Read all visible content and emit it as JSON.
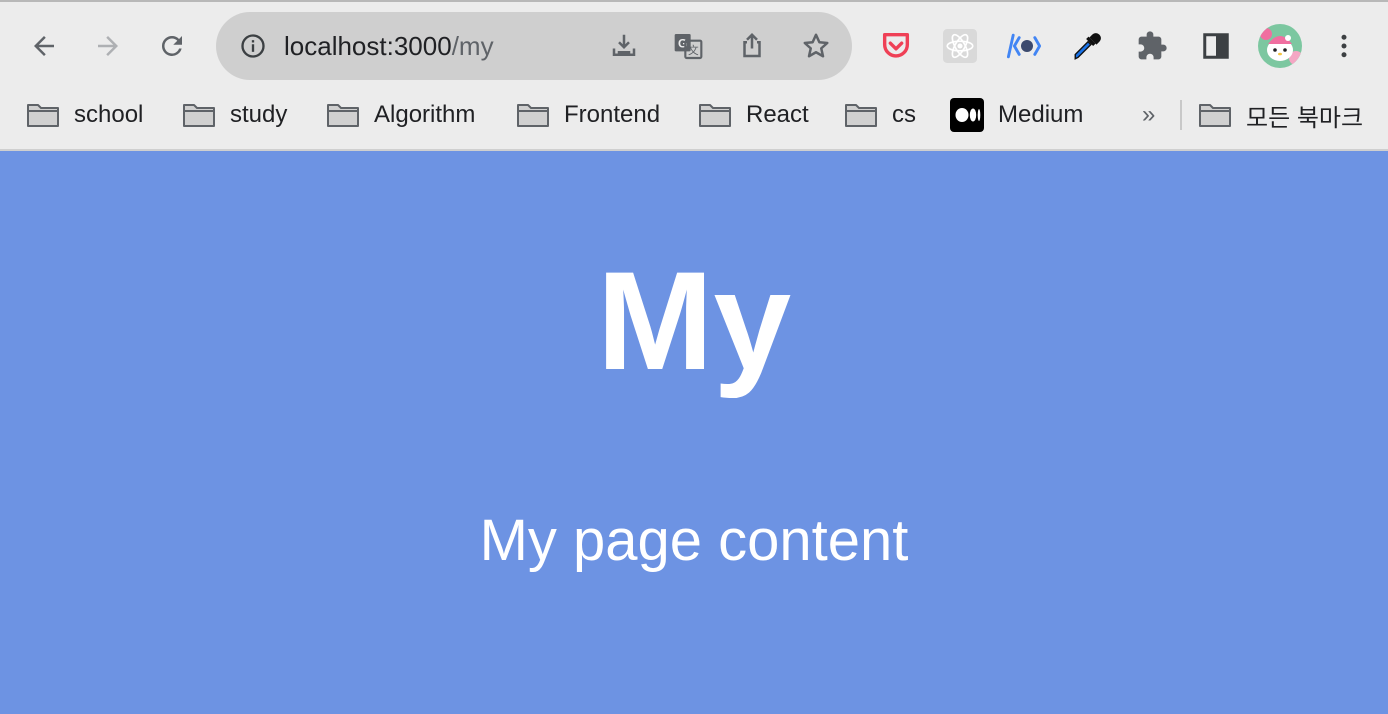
{
  "browser": {
    "url": {
      "host": "localhost:3000",
      "path": "/my"
    },
    "nav": {
      "back_icon": "arrow-left-icon",
      "forward_icon": "arrow-right-icon",
      "reload_icon": "reload-icon"
    },
    "omnibox_actions": [
      "install-app-icon",
      "translate-icon",
      "share-icon",
      "bookmark-star-icon"
    ],
    "extensions": [
      "pocket-icon",
      "react-devtools-icon",
      "octotree-icon",
      "eyedropper-icon",
      "extensions-puzzle-icon",
      "side-panel-icon",
      "profile-avatar",
      "more-menu-icon"
    ]
  },
  "bookmarks": {
    "items": [
      {
        "label": "school",
        "icon": "folder-icon"
      },
      {
        "label": "study",
        "icon": "folder-icon"
      },
      {
        "label": "Algorithm",
        "icon": "folder-icon"
      },
      {
        "label": "Frontend",
        "icon": "folder-icon"
      },
      {
        "label": "React",
        "icon": "folder-icon"
      },
      {
        "label": "cs",
        "icon": "folder-icon"
      },
      {
        "label": "Medium",
        "icon": "medium-icon"
      }
    ],
    "overflow": "»",
    "all_bookmarks": "모든 북마크"
  },
  "page": {
    "title": "My",
    "content": "My page content",
    "background": "#6d93e3",
    "text_color": "#ffffff"
  }
}
